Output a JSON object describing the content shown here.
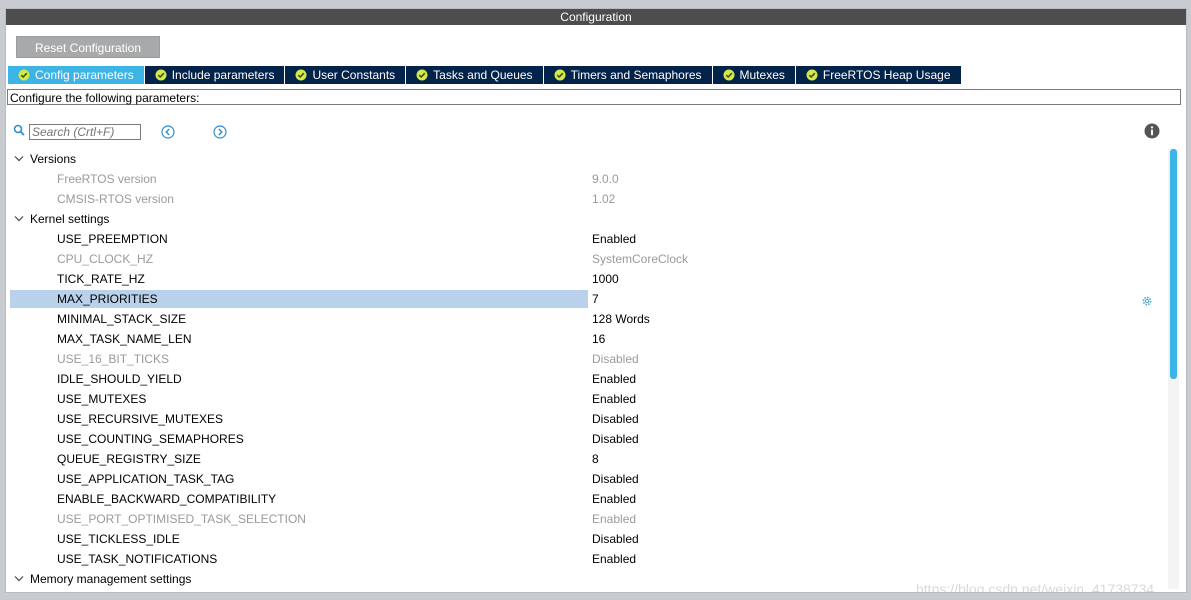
{
  "window": {
    "title": "Configuration"
  },
  "toolbar": {
    "reset_label": "Reset Configuration"
  },
  "tabs": [
    {
      "label": "Config parameters",
      "active": true
    },
    {
      "label": "Include parameters",
      "active": false
    },
    {
      "label": "User Constants",
      "active": false
    },
    {
      "label": "Tasks and Queues",
      "active": false
    },
    {
      "label": "Timers and Semaphores",
      "active": false
    },
    {
      "label": "Mutexes",
      "active": false
    },
    {
      "label": "FreeRTOS Heap Usage",
      "active": false
    }
  ],
  "description": "Configure the following parameters:",
  "search": {
    "placeholder": "Search (Crtl+F)"
  },
  "groups": [
    {
      "label": "Versions",
      "params": [
        {
          "name": "FreeRTOS version",
          "value": "9.0.0",
          "disabled": true
        },
        {
          "name": "CMSIS-RTOS version",
          "value": "1.02",
          "disabled": true
        }
      ]
    },
    {
      "label": "Kernel settings",
      "params": [
        {
          "name": "USE_PREEMPTION",
          "value": "Enabled"
        },
        {
          "name": "CPU_CLOCK_HZ",
          "value": "SystemCoreClock",
          "disabled": true
        },
        {
          "name": "TICK_RATE_HZ",
          "value": "1000"
        },
        {
          "name": "MAX_PRIORITIES",
          "value": "7",
          "selected": true
        },
        {
          "name": "MINIMAL_STACK_SIZE",
          "value": "128 Words"
        },
        {
          "name": "MAX_TASK_NAME_LEN",
          "value": "16"
        },
        {
          "name": "USE_16_BIT_TICKS",
          "value": "Disabled",
          "disabled": true
        },
        {
          "name": "IDLE_SHOULD_YIELD",
          "value": "Enabled"
        },
        {
          "name": "USE_MUTEXES",
          "value": "Enabled"
        },
        {
          "name": "USE_RECURSIVE_MUTEXES",
          "value": "Disabled"
        },
        {
          "name": "USE_COUNTING_SEMAPHORES",
          "value": "Disabled"
        },
        {
          "name": "QUEUE_REGISTRY_SIZE",
          "value": "8"
        },
        {
          "name": "USE_APPLICATION_TASK_TAG",
          "value": "Disabled"
        },
        {
          "name": "ENABLE_BACKWARD_COMPATIBILITY",
          "value": "Enabled"
        },
        {
          "name": "USE_PORT_OPTIMISED_TASK_SELECTION",
          "value": "Enabled",
          "disabled": true
        },
        {
          "name": "USE_TICKLESS_IDLE",
          "value": "Disabled"
        },
        {
          "name": "USE_TASK_NOTIFICATIONS",
          "value": "Enabled"
        }
      ]
    },
    {
      "label": "Memory management settings",
      "params": []
    }
  ],
  "watermark": "https://blog.csdn.net/weixin_41738734",
  "colors": {
    "accent": "#3cb4e5",
    "tab_bg": "#03234b",
    "selection": "#b9d1ea",
    "check": "#d4e84a"
  },
  "icons": [
    "search-icon",
    "arrow-left-icon",
    "arrow-right-icon",
    "info-icon",
    "gear-icon",
    "chevron-down-icon",
    "check-circle-icon"
  ]
}
